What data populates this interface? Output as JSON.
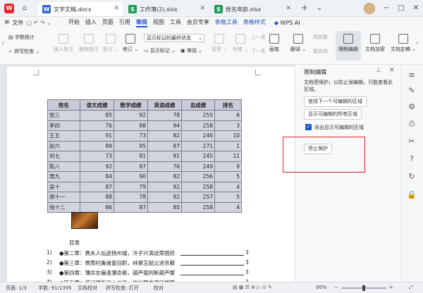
{
  "titlebar": {
    "tabs": [
      {
        "label": "文字文稿.docx",
        "icon": "W",
        "color": "#2b63d9",
        "active": true
      },
      {
        "label": "工作簿(2).xlsx",
        "icon": "S",
        "color": "#1f9a5b",
        "active": false
      },
      {
        "label": "姓名年龄.xlsx",
        "icon": "S",
        "color": "#1f9a5b",
        "active": false
      }
    ],
    "new_tab": "+"
  },
  "menubar": {
    "file": "文件",
    "items": [
      "开始",
      "插入",
      "页面",
      "引用",
      "审阅",
      "视图",
      "工具",
      "会员专享",
      "表格工具",
      "表格样式"
    ],
    "active": "审阅",
    "wps_ai": "WPS AI"
  },
  "ribbon": {
    "word_count": "字数统计",
    "spell_check": "拼写检查",
    "insert_comment": "插入批注",
    "delete_comment": "删除批注",
    "comment": "批注",
    "revise": "修订",
    "show_final": "显示标记的最终状态",
    "show_marks": "显示标记",
    "review": "审阅",
    "accept": "接受",
    "reject": "拒绝",
    "prev": "上一条",
    "next": "下一条",
    "ink": "画笔",
    "translate": "翻译",
    "simp": "简转繁",
    "trad": "繁转简",
    "restrict": "限制编辑",
    "encrypt": "文档加密",
    "finalize": "文档定稿"
  },
  "document": {
    "headers": [
      "姓名",
      "语文成绩",
      "数学成绩",
      "英语成绩",
      "总成绩",
      "排名"
    ],
    "rows": [
      [
        "张三",
        "85",
        "92",
        "78",
        "255",
        "6"
      ],
      [
        "李四",
        "76",
        "88",
        "94",
        "258",
        "3"
      ],
      [
        "王五",
        "91",
        "73",
        "82",
        "246",
        "10"
      ],
      [
        "赵六",
        "89",
        "95",
        "87",
        "271",
        "1"
      ],
      [
        "刘七",
        "73",
        "81",
        "91",
        "245",
        "11"
      ],
      [
        "陈八",
        "92",
        "87",
        "76",
        "249",
        "9"
      ],
      [
        "周九",
        "84",
        "90",
        "82",
        "256",
        "5"
      ],
      [
        "吴十",
        "87",
        "79",
        "92",
        "258",
        "4"
      ],
      [
        "郑十一",
        "88",
        "78",
        "92",
        "257",
        "5"
      ],
      [
        "钱十二",
        "86",
        "87",
        "85",
        "258",
        "4"
      ]
    ],
    "toc_title": "目录",
    "toc": [
      {
        "num": "1)",
        "text": "●第二章：费夫人仙逝扬州城，冷子兴演说荣国府",
        "page": "3"
      },
      {
        "num": "2)",
        "text": "●第三章：费雨村夤缘复旧职，林黛玉抛父进京都",
        "page": "3"
      },
      {
        "num": "3)",
        "text": "●第四章：薄命女偏逢薄命郎，葫芦僧判断葫芦案",
        "page": "3"
      },
      {
        "num": "4)",
        "text": "●第五章：游幻境指迷十二钗，饮仙醪曲演红楼梦",
        "page": "3"
      }
    ]
  },
  "panel": {
    "title": "限制编辑",
    "desc": "文档受保护，以防止误编辑。只能查看此区域。",
    "btn_next": "查找下一个可编辑的区域",
    "btn_show_all": "显示可编辑的所有区域",
    "chk_highlight": "突出显示可编辑的区域",
    "btn_stop": "停止保护",
    "highlight_color": "#e02020"
  },
  "statusbar": {
    "page": "页面: 1/3",
    "words": "字数: 91/1395",
    "doc_check": "文档校对",
    "spell_check": "拼写检查: 打开",
    "proof": "校对",
    "zoom": "90%"
  }
}
